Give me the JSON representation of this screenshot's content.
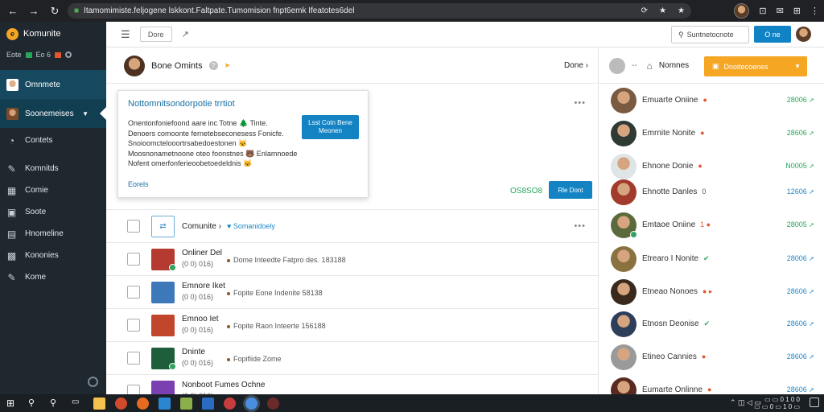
{
  "browser": {
    "nav": [
      "←",
      "→",
      "↻"
    ],
    "url": "Itamomimiste.feljogene lskkont.Faltpate.Tumomision fnpt6emk Ifeatotes6del",
    "right_icons": [
      "⟳",
      "★",
      "★",
      "⊡",
      "✉",
      "⊞",
      "⋮"
    ]
  },
  "sidebar": {
    "brand": "Komunite",
    "brand_logo": "e",
    "mini_label": "Eote",
    "mini_right": "Eo 6",
    "highlight1": "Omnmete",
    "highlight2": "Soonemeises",
    "items": [
      {
        "label": "Contets",
        "icon": "◔"
      },
      {
        "label": "Komnitds",
        "icon": "✎"
      },
      {
        "label": "Comie",
        "icon": "▦"
      },
      {
        "label": "Soote",
        "icon": "▣"
      },
      {
        "label": "Hnomeline",
        "icon": "▤"
      },
      {
        "label": "Kononies",
        "icon": "▩"
      },
      {
        "label": "Kome",
        "icon": "✎"
      }
    ]
  },
  "toolbar": {
    "chip": "Dore",
    "search": "Suntnetocnote",
    "button": "O ne"
  },
  "main": {
    "header_name": "Bone Omints",
    "done": "Done ›",
    "popup": {
      "title": "Nottomnitsondorpotie trrtiot",
      "lines": [
        "Onentonfoniefoond aare inc Totne 🌲 Tinte.",
        "Denoers comoonte fernetebseconesess Fonicfe.",
        "Snoioomctelooortrsabedoestonen 🐱",
        "Moosnonametnoone oteo foonstnes 🐻 Enlamnoede",
        "Nofent omerfonferieoobetoedeldnis 🐱"
      ],
      "button": "Lsst Cotn Bene Meonen",
      "link": "Eorels"
    },
    "ghost_score": "OS8SO8",
    "ghost_button": "Rle Dont",
    "rows": [
      {
        "title": "Comunite ›",
        "sub": "",
        "desc": "Somanidoely",
        "type": "tag"
      },
      {
        "title": "Onliner Del",
        "sub": "(0 0) 016)",
        "desc": "Dome Inteedte Fatpro des. 183188",
        "color": "#b53a2f"
      },
      {
        "title": "Emnore Iket",
        "sub": "(0 0) 016)",
        "desc": "Fopite Eone Indenite 58138",
        "color": "#3d78b8"
      },
      {
        "title": "Emnoo Iet",
        "sub": "(0 0) 016)",
        "desc": "Fopite Raon Inteerte 156188",
        "color": "#c1462b"
      },
      {
        "title": "Dninte",
        "sub": "(0 0) 016)",
        "desc": "Fopifiide Zome",
        "color": "#1f5e3a"
      },
      {
        "title": "Nonboot Fumes Ochne",
        "sub": "(0 0) 016)",
        "desc": "",
        "color": "#7a3fb0"
      }
    ]
  },
  "rpanel": {
    "label": "Nomnes",
    "button": "Dnoitecoenes",
    "items": [
      {
        "name": "Emuarte Oniine",
        "status": "●",
        "statusColor": "#e4572e",
        "score": "28006",
        "scoreColor": "green",
        "av": "#7a5a40"
      },
      {
        "name": "Emrnite Nonite",
        "status": "●",
        "statusColor": "#e4572e",
        "score": "28606",
        "scoreColor": "green",
        "av": "#2e3a33"
      },
      {
        "name": "Ehnone Donie",
        "status": "●",
        "statusColor": "#e4572e",
        "score": "N0005",
        "scoreColor": "green",
        "av": "#dfe4e6"
      },
      {
        "name": "Ehnotte Danles",
        "status": "0",
        "statusColor": "#555",
        "score": "12606",
        "scoreColor": "blue",
        "av": "#a23b2c"
      },
      {
        "name": "Emtaoe Oniine",
        "status": "1 ●",
        "statusColor": "#e4572e",
        "score": "28005",
        "scoreColor": "green",
        "av": "#5b6a3d"
      },
      {
        "name": "Etrearo I Nonite",
        "status": "✔",
        "statusColor": "#2fa360",
        "score": "28006",
        "scoreColor": "blue",
        "av": "#8a7240"
      },
      {
        "name": "Etneao Nonoes",
        "status": "● ▸",
        "statusColor": "#e4572e",
        "score": "28606",
        "scoreColor": "blue",
        "av": "#3a2a1e"
      },
      {
        "name": "Etnosn Deonise",
        "status": "✔",
        "statusColor": "#2fa360",
        "score": "28606",
        "scoreColor": "blue",
        "av": "#2c3e5a"
      },
      {
        "name": "Etineo Cannies",
        "status": "●",
        "statusColor": "#e4572e",
        "score": "28606",
        "scoreColor": "blue",
        "av": "#9a9a9a"
      },
      {
        "name": "Eumarte Onlinne",
        "status": "●",
        "statusColor": "#e4572e",
        "score": "28606",
        "scoreColor": "blue",
        "av": "#5a2a20"
      }
    ]
  },
  "taskbar": {
    "tray": "⌃ ◫ ◁ ▭",
    "time": "▭ ▭ 0 1 0 0",
    "date": "▭ ▭ 0 ▭ 1 0 ▭"
  }
}
